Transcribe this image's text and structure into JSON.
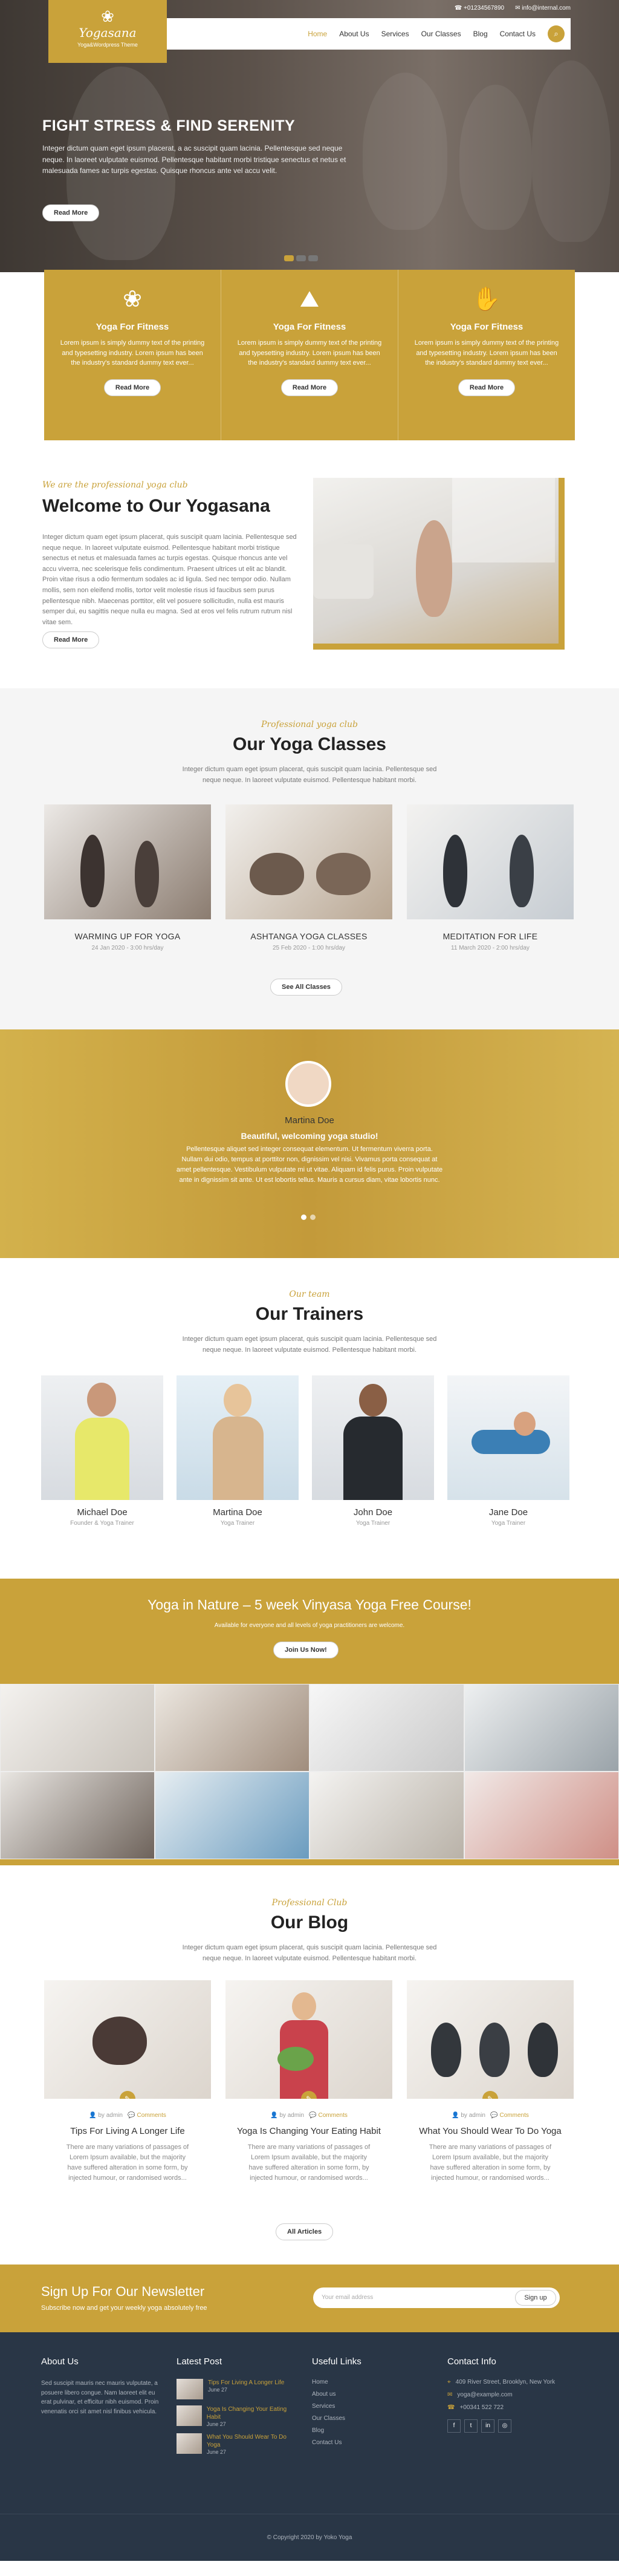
{
  "topbar": {
    "phone": "+01234567890",
    "email": "info@internal.com"
  },
  "logo": {
    "name": "Yogasana",
    "tagline": "Yoga&Wordpress Theme"
  },
  "nav": {
    "items": [
      "Home",
      "About Us",
      "Services",
      "Our Classes",
      "Blog",
      "Contact Us"
    ],
    "active": "Home"
  },
  "hero": {
    "title": "FIGHT STRESS & FIND SERENITY",
    "text": "Integer dictum quam eget ipsum placerat, a ac suscipit quam lacinia. Pellentesque sed neque neque. In laoreet vulputate euismod. Pellentesque habitant morbi tristique senectus et netus et malesuada fames ac turpis egestas. Quisque rhoncus ante vel accu velit.",
    "button": "Read More"
  },
  "features": [
    {
      "title": "Yoga For Fitness",
      "text": "Lorem ipsum is simply dummy text of the printing and typesetting industry. Lorem ipsum has been the industry's standard dummy text ever...",
      "button": "Read More"
    },
    {
      "title": "Yoga For Fitness",
      "text": "Lorem ipsum is simply dummy text of the printing and typesetting industry. Lorem ipsum has been the industry's standard dummy text ever...",
      "button": "Read More"
    },
    {
      "title": "Yoga For Fitness",
      "text": "Lorem ipsum is simply dummy text of the printing and typesetting industry. Lorem ipsum has been the industry's standard dummy text ever...",
      "button": "Read More"
    }
  ],
  "welcome": {
    "subtitle": "We are the professional yoga club",
    "title": "Welcome to Our Yogasana",
    "text": "Integer dictum quam eget ipsum placerat, quis suscipit quam lacinia. Pellentesque sed neque neque. In laoreet vulputate euismod. Pellentesque habitant morbi tristique senectus et netus et malesuada fames ac turpis egestas. Quisque rhoncus ante vel accu viverra, nec scelerisque felis condimentum. Praesent ultrices ut elit ac blandit. Proin vitae risus a odio fermentum sodales ac id ligula. Sed nec tempor odio. Nullam mollis, sem non eleifend mollis, tortor velit molestie risus id faucibus sem purus pellentesque nibh. Maecenas porttitor, elit vel posuere sollicitudin, nulla est mauris semper dui, eu sagittis neque nulla eu magna. Sed at eros vel felis rutrum rutrum nisl vitae sem.",
    "button": "Read More"
  },
  "classes": {
    "subtitle": "Professional yoga club",
    "title": "Our Yoga Classes",
    "text": "Integer dictum quam eget ipsum placerat, quis suscipit quam lacinia. Pellentesque sed neque neque. In laoreet vulputate euismod. Pellentesque habitant morbi.",
    "items": [
      {
        "title": "WARMING UP FOR YOGA",
        "meta": "24 Jan 2020 - 3:00 hrs/day"
      },
      {
        "title": "ASHTANGA YOGA CLASSES",
        "meta": "25 Feb 2020 - 1:00 hrs/day"
      },
      {
        "title": "MEDITATION FOR LIFE",
        "meta": "11 March 2020 - 2:00 hrs/day"
      }
    ],
    "button": "See All Classes"
  },
  "testimonial": {
    "name": "Martina Doe",
    "quote": "Beautiful, welcoming yoga studio!",
    "text": "Pellentesque aliquet sed integer consequat elementum. Ut fermentum viverra porta. Nullam dui odio, tempus at porttitor non, dignissim vel nisi. Vivamus porta consequat at amet pellentesque. Vestibulum vulputate mi ut vitae. Aliquam id felis purus. Proin vulputate ante in dignissim sit ante. Ut est lobortis tellus. Mauris a cursus diam, vitae lobortis nunc."
  },
  "trainers": {
    "subtitle": "Our team",
    "title": "Our Trainers",
    "text": "Integer dictum quam eget ipsum placerat, quis suscipit quam lacinia. Pellentesque sed neque neque. In laoreet vulputate euismod. Pellentesque habitant morbi.",
    "items": [
      {
        "name": "Michael Doe",
        "role": "Founder & Yoga Trainer"
      },
      {
        "name": "Martina Doe",
        "role": "Yoga Trainer"
      },
      {
        "name": "John Doe",
        "role": "Yoga Trainer"
      },
      {
        "name": "Jane Doe",
        "role": "Yoga Trainer"
      }
    ]
  },
  "cta": {
    "title": "Yoga in Nature – 5 week Vinyasa Yoga Free Course!",
    "text": "Available for everyone and all levels of yoga practitioners are welcome.",
    "button": "Join Us Now!"
  },
  "blog": {
    "subtitle": "Professional Club",
    "title": "Our Blog",
    "text": "Integer dictum quam eget ipsum placerat, quis suscipit quam lacinia. Pellentesque sed neque neque. In laoreet vulputate euismod. Pellentesque habitant morbi.",
    "posts": [
      {
        "author": "by admin",
        "comments": "Comments",
        "title": "Tips For Living A Longer Life",
        "text": "There are many variations of passages of Lorem Ipsum available, but the majority have suffered alteration in some form, by injected humour, or randomised words..."
      },
      {
        "author": "by admin",
        "comments": "Comments",
        "title": "Yoga Is Changing Your Eating Habit",
        "text": "There are many variations of passages of Lorem Ipsum available, but the majority have suffered alteration in some form, by injected humour, or randomised words..."
      },
      {
        "author": "by admin",
        "comments": "Comments",
        "title": "What You Should Wear To Do Yoga",
        "text": "There are many variations of passages of Lorem Ipsum available, but the majority have suffered alteration in some form, by injected humour, or randomised words..."
      }
    ],
    "button": "All Articles"
  },
  "newsletter": {
    "title": "Sign Up For Our Newsletter",
    "text": "Subscribe now and get your weekly yoga absolutely free",
    "placeholder": "Your email address",
    "button": "Sign up"
  },
  "footer": {
    "about": {
      "title": "About Us",
      "text": "Sed suscipit mauris nec mauris vulputate, a posuere libero congue. Nam laoreet elit eu erat pulvinar, et efficitur nibh euismod. Proin venenatis orci sit amet nisl finibus vehicula."
    },
    "latest": {
      "title": "Latest Post",
      "items": [
        {
          "title": "Tips For Living A Longer Life",
          "date": "June 27"
        },
        {
          "title": "Yoga Is Changing Your Eating Habit",
          "date": "June 27"
        },
        {
          "title": "What You Should Wear To Do Yoga",
          "date": "June 27"
        }
      ]
    },
    "links": {
      "title": "Useful Links",
      "items": [
        "Home",
        "About us",
        "Services",
        "Our Classes",
        "Blog",
        "Contact Us"
      ]
    },
    "contact": {
      "title": "Contact Info",
      "address": "409 River Street, Brooklyn, New York",
      "email": "yoga@example.com",
      "phone": "+00341 522 722"
    },
    "social": [
      "f",
      "t",
      "in",
      "◎"
    ]
  },
  "copyright": "© Copyright 2020 by Yoko Yoga",
  "colors": {
    "accent": "#c9a23a",
    "footer": "#293646"
  }
}
